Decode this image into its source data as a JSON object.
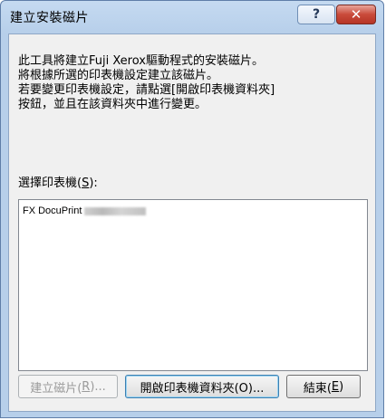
{
  "window": {
    "title": "建立安裝磁片",
    "help_glyph": "?",
    "close_glyph": "✕"
  },
  "description": {
    "lines": [
      "此工具將建立Fuji Xerox驅動程式的安裝磁片。",
      "將根據所選的印表機設定建立該磁片。",
      "若要變更印表機設定，請點選[開啟印表機資料夾]",
      "按鈕，並且在該資料夾中進行變更。"
    ]
  },
  "printer_select": {
    "label_prefix": "選擇印表機(",
    "label_accel": "S",
    "label_suffix": "):",
    "items": [
      {
        "text": "FX DocuPrint",
        "redacted": true
      }
    ]
  },
  "buttons": {
    "create": {
      "label_prefix": "建立磁片(",
      "accel": "R",
      "label_suffix": ")...",
      "enabled": false
    },
    "open_folder": {
      "label": "開啟印表機資料夾(O)...",
      "enabled": true
    },
    "close": {
      "label_prefix": "結束(",
      "accel": "E",
      "label_suffix": ")",
      "enabled": true
    }
  }
}
